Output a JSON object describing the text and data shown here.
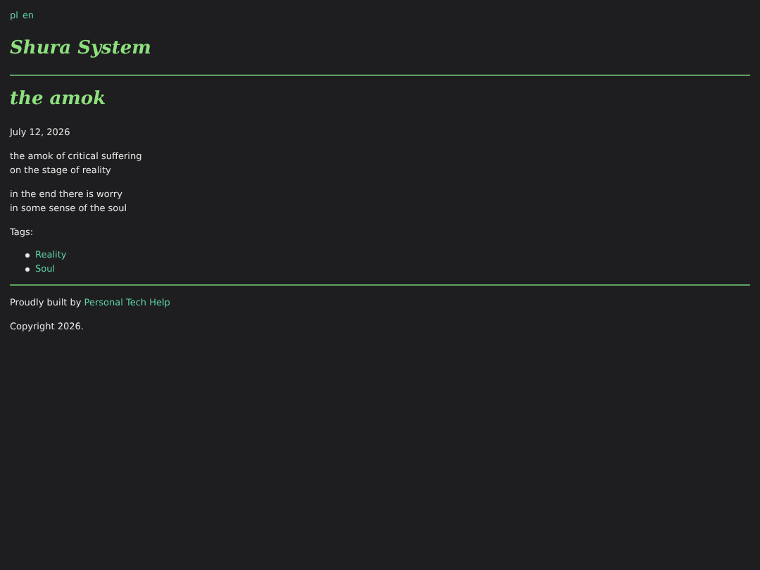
{
  "languages": [
    {
      "label": "pl"
    },
    {
      "label": "en"
    }
  ],
  "site_title": "Shura System",
  "post": {
    "title": "the amok",
    "date": "July 12, 2026",
    "stanzas": [
      [
        "the amok of critical suffering",
        "on the stage of reality"
      ],
      [
        "in the end there is worry",
        "in some sense of the soul"
      ]
    ],
    "tags_label": "Tags:",
    "tags": [
      "Reality",
      "Soul"
    ]
  },
  "footer": {
    "built_by": "Proudly built by",
    "link": "Personal Tech Help",
    "copyright": "Copyright 2026."
  }
}
